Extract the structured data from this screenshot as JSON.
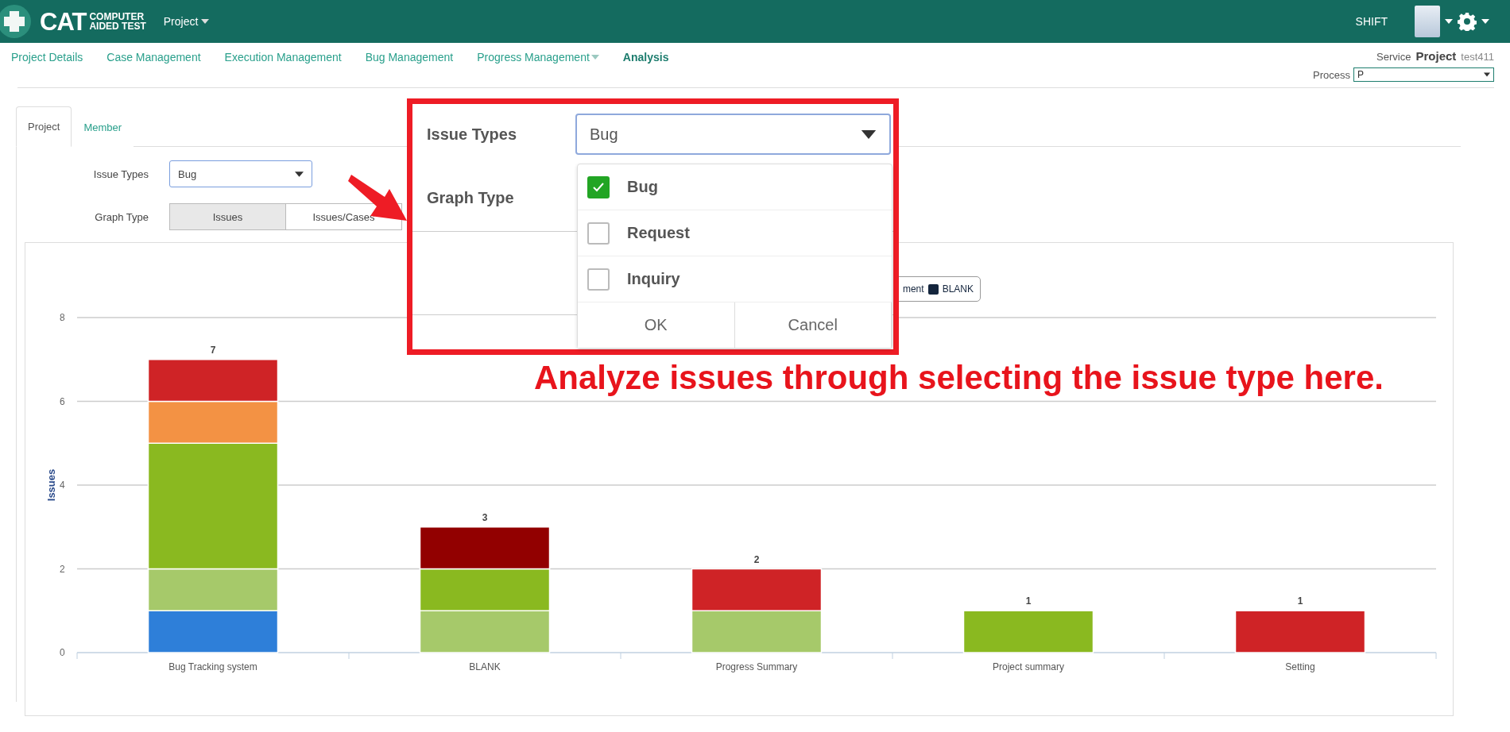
{
  "header": {
    "logo": {
      "mark": "CAT",
      "line1": "COMPUTER",
      "line2": "AIDED TEST"
    },
    "menu": "Project",
    "user": "SHIFT"
  },
  "nav": [
    {
      "label": "Project Details",
      "selected": false,
      "dropdown": false
    },
    {
      "label": "Case Management",
      "selected": false,
      "dropdown": false
    },
    {
      "label": "Execution Management",
      "selected": false,
      "dropdown": false
    },
    {
      "label": "Bug Management",
      "selected": false,
      "dropdown": false
    },
    {
      "label": "Progress Management",
      "selected": false,
      "dropdown": true
    },
    {
      "label": "Analysis",
      "selected": true,
      "dropdown": false
    }
  ],
  "service": {
    "label": "Service",
    "project": "Project",
    "name": "test411"
  },
  "process": {
    "label": "Process",
    "value": "P"
  },
  "tabs": [
    {
      "label": "Project",
      "selected": true
    },
    {
      "label": "Member",
      "selected": false
    }
  ],
  "filters": {
    "issue_types": {
      "label": "Issue Types",
      "value": "Bug"
    },
    "graph_type": {
      "label": "Graph Type",
      "options": [
        {
          "label": "Issues",
          "selected": true
        },
        {
          "label": "Issues/Cases",
          "selected": false
        }
      ]
    }
  },
  "chart": {
    "totals": [
      "7",
      "3",
      "2",
      "1",
      "1"
    ],
    "legend": [
      {
        "label": "ment"
      },
      {
        "label": "BLANK",
        "color": "#14253d"
      }
    ],
    "chart_data": {
      "type": "bar",
      "ylabel": "Issues",
      "categories": [
        "Bug Tracking system",
        "BLANK",
        "Progress Summary",
        "Project summary",
        "Setting"
      ],
      "stacked": true,
      "ylim": [
        0,
        8
      ],
      "yticks": [
        0,
        2,
        4,
        6,
        8
      ],
      "grid": true,
      "series": [
        {
          "color": "#2e7fd9",
          "values": [
            1,
            0,
            0,
            0,
            0
          ]
        },
        {
          "color": "#a6c96a",
          "values": [
            1,
            1,
            1,
            0,
            0
          ]
        },
        {
          "color": "#8ab920",
          "values": [
            3,
            1,
            0,
            1,
            0
          ]
        },
        {
          "color": "#f39244",
          "values": [
            1,
            0,
            0,
            0,
            0
          ]
        },
        {
          "color": "#cf2326",
          "values": [
            1,
            0,
            1,
            0,
            1
          ]
        },
        {
          "color": "#920000",
          "values": [
            0,
            1,
            0,
            0,
            0
          ]
        }
      ]
    }
  },
  "callout": {
    "issue_types_label": "Issue Types",
    "value": "Bug",
    "graph_type_label": "Graph Type",
    "options": [
      {
        "label": "Bug",
        "checked": true
      },
      {
        "label": "Request",
        "checked": false
      },
      {
        "label": "Inquiry",
        "checked": false
      }
    ],
    "ok": "OK",
    "cancel": "Cancel"
  },
  "annotation": "Analyze issues through selecting the issue type here."
}
